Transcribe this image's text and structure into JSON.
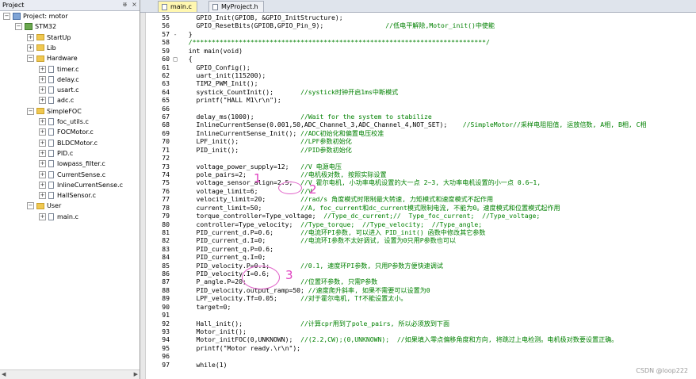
{
  "project_panel": {
    "title": "Project",
    "pin_glyph": "ᵿ",
    "close_glyph": "×",
    "tree": [
      {
        "label": "Project: motor",
        "level": 0,
        "kind": "project",
        "toggle": "−"
      },
      {
        "label": "STM32",
        "level": 1,
        "kind": "target",
        "toggle": "−"
      },
      {
        "label": "StartUp",
        "level": 2,
        "kind": "folder",
        "toggle": "+"
      },
      {
        "label": "Lib",
        "level": 2,
        "kind": "folder",
        "toggle": "+"
      },
      {
        "label": "Hardware",
        "level": 2,
        "kind": "folder",
        "toggle": "−"
      },
      {
        "label": "timer.c",
        "level": 3,
        "kind": "file",
        "toggle": "+"
      },
      {
        "label": "delay.c",
        "level": 3,
        "kind": "file",
        "toggle": "+"
      },
      {
        "label": "usart.c",
        "level": 3,
        "kind": "file",
        "toggle": "+"
      },
      {
        "label": "adc.c",
        "level": 3,
        "kind": "file",
        "toggle": "+"
      },
      {
        "label": "SimpleFOC",
        "level": 2,
        "kind": "folder",
        "toggle": "−"
      },
      {
        "label": "foc_utils.c",
        "level": 3,
        "kind": "file",
        "toggle": "+"
      },
      {
        "label": "FOCMotor.c",
        "level": 3,
        "kind": "file",
        "toggle": "+"
      },
      {
        "label": "BLDCMotor.c",
        "level": 3,
        "kind": "file",
        "toggle": "+"
      },
      {
        "label": "PID.c",
        "level": 3,
        "kind": "file",
        "toggle": "+"
      },
      {
        "label": "lowpass_filter.c",
        "level": 3,
        "kind": "file",
        "toggle": "+"
      },
      {
        "label": "CurrentSense.c",
        "level": 3,
        "kind": "file",
        "toggle": "+"
      },
      {
        "label": "InlineCurrentSense.c",
        "level": 3,
        "kind": "file",
        "toggle": "+"
      },
      {
        "label": "HallSensor.c",
        "level": 3,
        "kind": "file",
        "toggle": "+"
      },
      {
        "label": "User",
        "level": 2,
        "kind": "folder",
        "toggle": "−"
      },
      {
        "label": "main.c",
        "level": 3,
        "kind": "file",
        "toggle": "+"
      }
    ]
  },
  "tabs": [
    {
      "label": "main.c",
      "active": true
    },
    {
      "label": "MyProject.h",
      "active": false
    }
  ],
  "code_lines": [
    {
      "n": "55",
      "fold": "",
      "code": "    GPIO_Init(GPIOB, &GPIO_InitStructure);",
      "comment": ""
    },
    {
      "n": "56",
      "fold": "",
      "code": "    GPIO_ResetBits(GPIOB,GPIO_Pin_9);",
      "comment": "                //低电平解除,Motor_init()中使能"
    },
    {
      "n": "57",
      "fold": "-",
      "code": "  }",
      "comment": ""
    },
    {
      "n": "58",
      "fold": "",
      "code": "  ",
      "comment": "/****************************************************************************/"
    },
    {
      "n": "59",
      "fold": "",
      "code": "  int main(void)",
      "comment": ""
    },
    {
      "n": "60",
      "fold": "□",
      "code": "  {",
      "comment": ""
    },
    {
      "n": "61",
      "fold": "",
      "code": "    GPIO_Config();",
      "comment": ""
    },
    {
      "n": "62",
      "fold": "",
      "code": "    uart_init(115200);",
      "comment": ""
    },
    {
      "n": "63",
      "fold": "",
      "code": "    TIM2_PWM_Init();",
      "comment": ""
    },
    {
      "n": "64",
      "fold": "",
      "code": "    systick_CountInit();",
      "comment": "       //systick时钟开启1ms中断模式"
    },
    {
      "n": "65",
      "fold": "",
      "code": "    printf(\"HALL M1\\r\\n\");",
      "comment": ""
    },
    {
      "n": "66",
      "fold": "",
      "code": "",
      "comment": ""
    },
    {
      "n": "67",
      "fold": "",
      "code": "    delay_ms(1000);",
      "comment": "            //Wait for the system to stabilize"
    },
    {
      "n": "68",
      "fold": "",
      "code": "    InlineCurrentSense(0.001,50,ADC_Channel_3,ADC_Channel_4,NOT_SET);",
      "comment": "    //SimpleMotor//采样电阻阻值, 运放倍数, A相, B相, C相"
    },
    {
      "n": "69",
      "fold": "",
      "code": "    InlineCurrentSense_Init();",
      "comment": " //ADC初始化和偏置电压校准"
    },
    {
      "n": "70",
      "fold": "",
      "code": "    LPF_init();",
      "comment": "                //LPF参数初始化"
    },
    {
      "n": "71",
      "fold": "",
      "code": "    PID_init();",
      "comment": "                //PID参数初始化"
    },
    {
      "n": "72",
      "fold": "",
      "code": "",
      "comment": ""
    },
    {
      "n": "73",
      "fold": "",
      "code": "    voltage_power_supply=12;",
      "comment": "   //V 电源电压"
    },
    {
      "n": "74",
      "fold": "",
      "code": "    pole_pairs=2;",
      "comment": "              //电机极对数, 按照实际设置"
    },
    {
      "n": "75",
      "fold": "",
      "code": "    voltage_sensor_align=2.5;",
      "comment": "  //V 霍尔电机, 小功率电机设置的大一点 2~3, 大功率电机设置的小一点 0.6~1,"
    },
    {
      "n": "76",
      "fold": "",
      "code": "    voltage_limit=6;",
      "comment": "           //V"
    },
    {
      "n": "77",
      "fold": "",
      "code": "    velocity_limit=20;",
      "comment": "         //rad/s 角度模式时限制最大转速, 力矩模式和速度模式不起作用"
    },
    {
      "n": "78",
      "fold": "",
      "code": "    current_limit=50;",
      "comment": "          //A, foc_current和dc_current模式限制电流, 不能为0。速度模式和位置模式起作用"
    },
    {
      "n": "79",
      "fold": "",
      "code": "    torque_controller=Type_voltage;",
      "comment": "  //Type_dc_current;//  Type_foc_current;  //Type_voltage;"
    },
    {
      "n": "80",
      "fold": "",
      "code": "    controller=Type_velocity;",
      "comment": "  //Type_torque;  //Type_velocity;  //Type_angle;"
    },
    {
      "n": "81",
      "fold": "",
      "code": "    PID_current_d.P=0.6;",
      "comment": "       //电流环PI参数, 可以进入 PID_init() 函数中修改其它参数"
    },
    {
      "n": "82",
      "fold": "",
      "code": "    PID_current_d.I=0;",
      "comment": "         //电流环I参数不太好调试, 设置为0只用P参数也可以"
    },
    {
      "n": "83",
      "fold": "",
      "code": "    PID_current_q.P=0.6;",
      "comment": ""
    },
    {
      "n": "84",
      "fold": "",
      "code": "    PID_current_q.I=0;",
      "comment": ""
    },
    {
      "n": "85",
      "fold": "",
      "code": "    PID_velocity.P=0.1;",
      "comment": "        //0.1, 速度环PI参数, 只用P参数方便快速调试"
    },
    {
      "n": "86",
      "fold": "",
      "code": "    PID_velocity.I=0.6;",
      "comment": ""
    },
    {
      "n": "87",
      "fold": "",
      "code": "    P_angle.P=20;",
      "comment": "              //位置环参数, 只需P参数"
    },
    {
      "n": "88",
      "fold": "",
      "code": "    PID_velocity.output_ramp=50;",
      "comment": " //速度爬升斜率, 如果不需要可以设置为0"
    },
    {
      "n": "89",
      "fold": "",
      "code": "    LPF_velocity.Tf=0.05;",
      "comment": "      //对于霍尔电机, Tf不能设置太小。"
    },
    {
      "n": "90",
      "fold": "",
      "code": "    target=0;",
      "comment": ""
    },
    {
      "n": "91",
      "fold": "",
      "code": "",
      "comment": ""
    },
    {
      "n": "92",
      "fold": "",
      "code": "    Hall_init();",
      "comment": "               //计算cpr用到了pole_pairs, 所以必须放到下面"
    },
    {
      "n": "93",
      "fold": "",
      "code": "    Motor_init();",
      "comment": ""
    },
    {
      "n": "94",
      "fold": "",
      "code": "    Motor_initFOC(0,UNKNOWN);",
      "comment": "  //(2.2,CW);(0,UNKNOWN);  //如果填入零点偏移角度和方向, 将跳过上电检测。电机极对数要设置正确。"
    },
    {
      "n": "95",
      "fold": "",
      "code": "    printf(\"Motor ready.\\r\\n\");",
      "comment": ""
    },
    {
      "n": "96",
      "fold": "",
      "code": "",
      "comment": ""
    },
    {
      "n": "97",
      "fold": "",
      "code": "    while(1)",
      "comment": ""
    }
  ],
  "annotations": [
    {
      "label": "1"
    },
    {
      "label": "2"
    },
    {
      "label": "3"
    }
  ],
  "watermark": "CSDN @loop222"
}
